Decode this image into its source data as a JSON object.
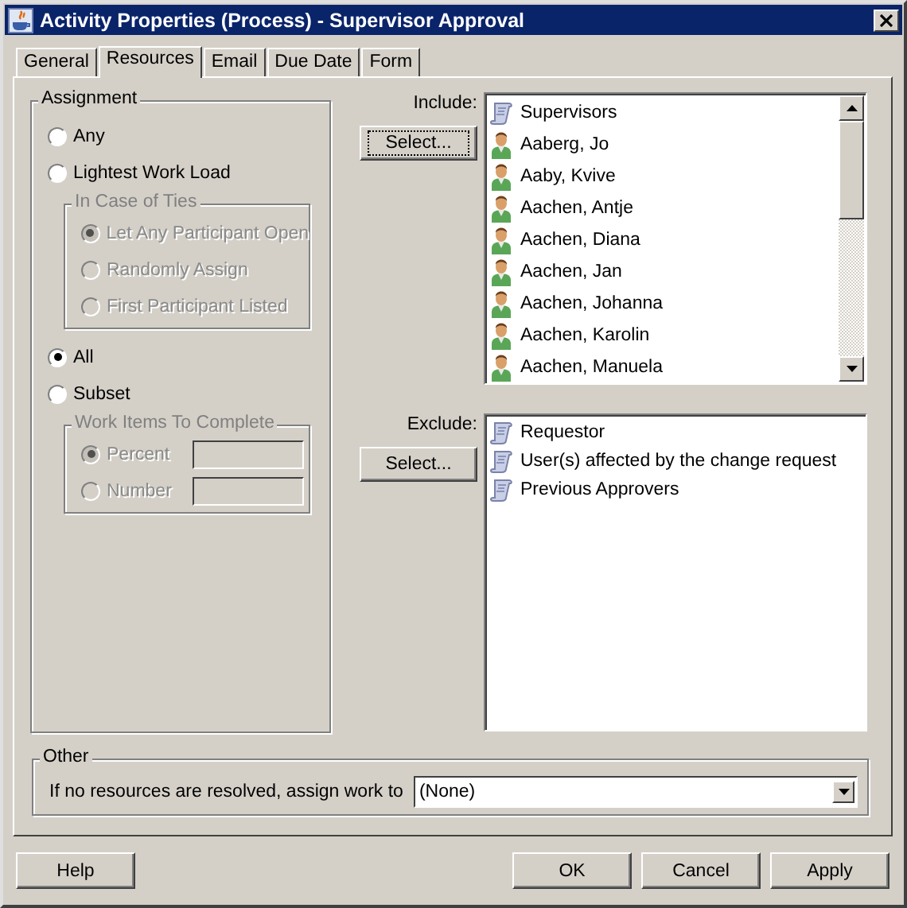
{
  "window": {
    "title": "Activity Properties (Process) - Supervisor Approval"
  },
  "tabs": [
    {
      "label": "General",
      "selected": false
    },
    {
      "label": "Resources",
      "selected": true
    },
    {
      "label": "Email",
      "selected": false
    },
    {
      "label": "Due Date",
      "selected": false
    },
    {
      "label": "Form",
      "selected": false
    }
  ],
  "assignment": {
    "legend": "Assignment",
    "options": [
      {
        "label": "Any",
        "selected": false,
        "disabled": false
      },
      {
        "label": "Lightest Work Load",
        "selected": false,
        "disabled": false,
        "group": {
          "legend": "In Case of Ties",
          "options": [
            {
              "kind": "radio",
              "label": "Let Any Participant Open",
              "selected": true,
              "disabled": true
            },
            {
              "kind": "radio",
              "label": "Randomly Assign",
              "selected": false,
              "disabled": true
            },
            {
              "kind": "radio",
              "label": "First Participant Listed",
              "selected": false,
              "disabled": true
            }
          ]
        }
      },
      {
        "label": "All",
        "selected": true,
        "disabled": false
      },
      {
        "label": "Subset",
        "selected": false,
        "disabled": false,
        "group": {
          "legend": "Work Items To Complete",
          "options": [
            {
              "kind": "radio_field",
              "label": "Percent",
              "selected": true,
              "disabled": true
            },
            {
              "kind": "radio_field",
              "label": "Number",
              "selected": false,
              "disabled": true
            }
          ]
        }
      }
    ]
  },
  "include": {
    "label": "Include:",
    "button": {
      "label": "Select...",
      "focused": true
    },
    "items": [
      {
        "kind": "group",
        "label": "Supervisors"
      },
      {
        "kind": "user",
        "label": "Aaberg, Jo"
      },
      {
        "kind": "user",
        "label": "Aaby, Kvive"
      },
      {
        "kind": "user",
        "label": "Aachen, Antje"
      },
      {
        "kind": "user",
        "label": "Aachen, Diana"
      },
      {
        "kind": "user",
        "label": "Aachen, Jan"
      },
      {
        "kind": "user",
        "label": "Aachen, Johanna"
      },
      {
        "kind": "user",
        "label": "Aachen, Karolin"
      },
      {
        "kind": "user",
        "label": "Aachen, Manuela"
      }
    ]
  },
  "exclude": {
    "label": "Exclude:",
    "button": {
      "label": "Select...",
      "focused": false
    },
    "items": [
      {
        "kind": "group",
        "label": "Requestor"
      },
      {
        "kind": "group",
        "label": "User(s) affected by the change request"
      },
      {
        "kind": "group",
        "label": "Previous Approvers"
      }
    ]
  },
  "other": {
    "legend": "Other",
    "label": "If no resources are resolved, assign work to",
    "value": "(None)"
  },
  "buttons_left": [
    {
      "label": "Help"
    }
  ],
  "buttons_right": [
    {
      "label": "OK"
    },
    {
      "label": "Cancel"
    },
    {
      "label": "Apply"
    }
  ]
}
